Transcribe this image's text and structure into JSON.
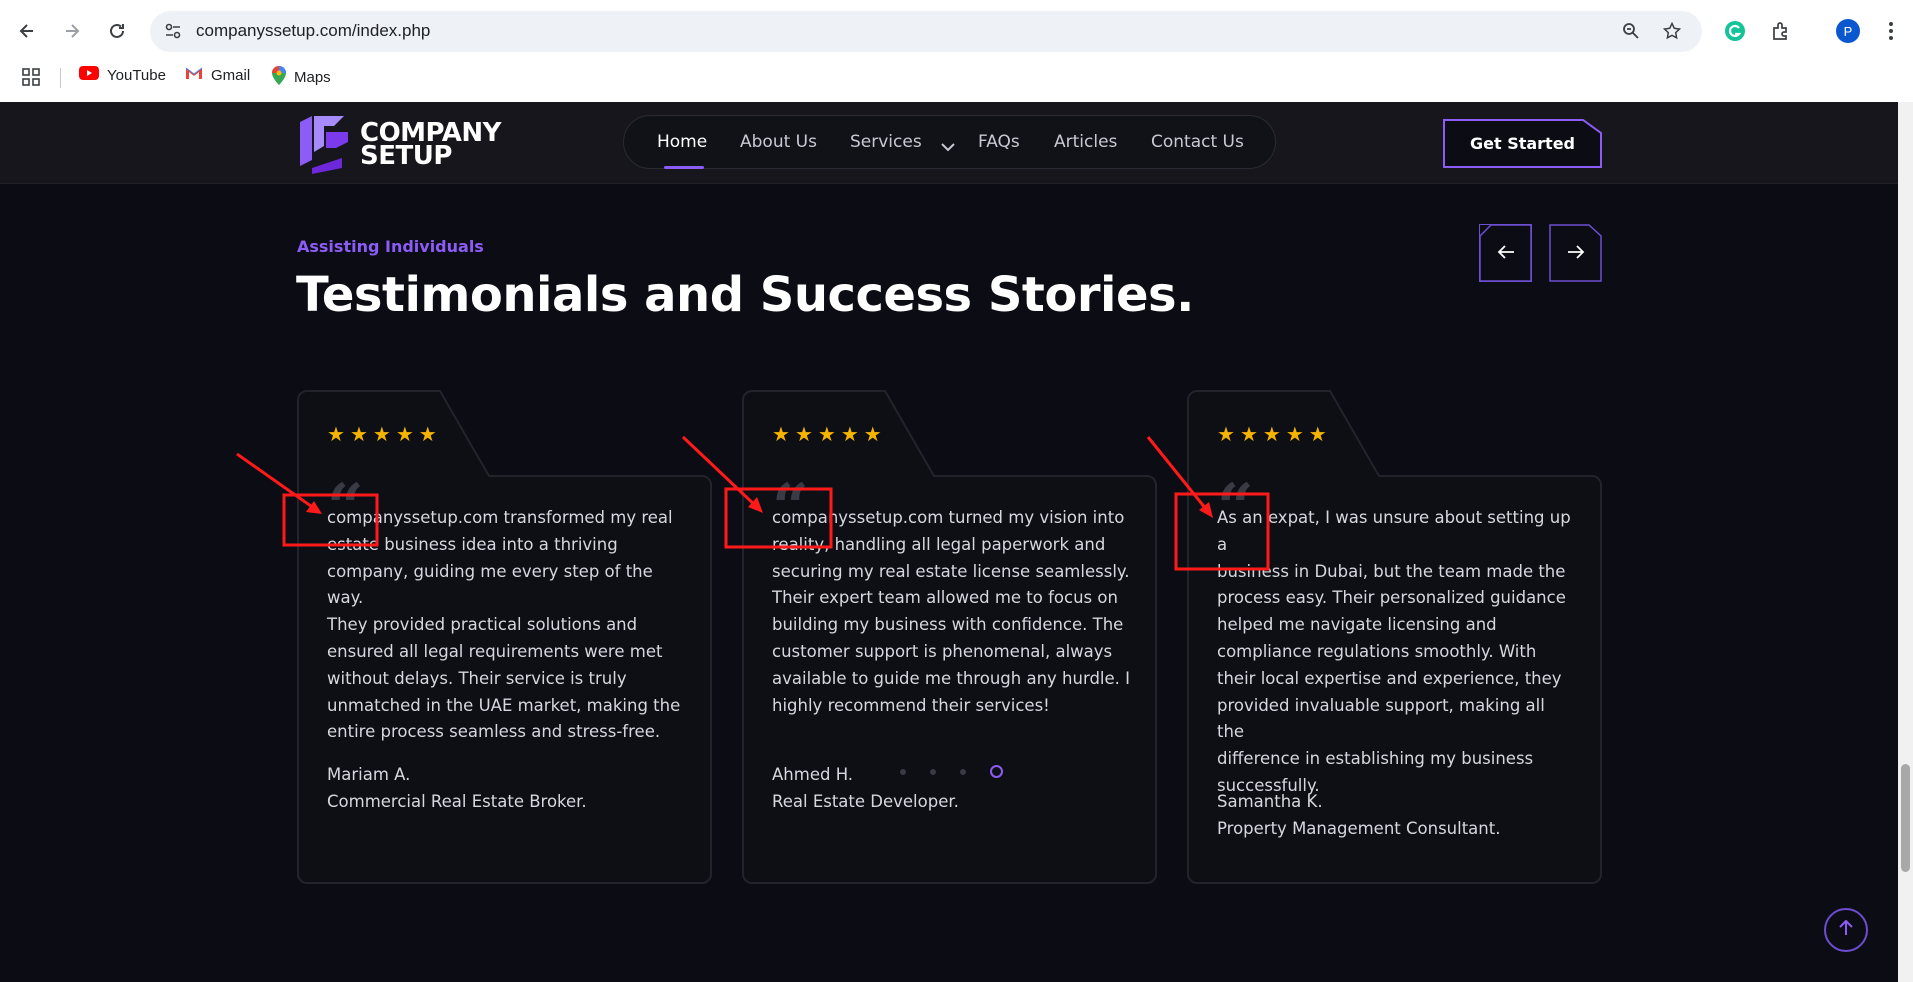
{
  "browser": {
    "url": "companyssetup.com/index.php",
    "bookmarks": [
      {
        "label": "YouTube",
        "icon": "youtube-icon"
      },
      {
        "label": "Gmail",
        "icon": "gmail-icon"
      },
      {
        "label": "Maps",
        "icon": "maps-icon"
      }
    ],
    "profile_initial": "P"
  },
  "header": {
    "logo_line1": "COMPANY",
    "logo_line2": "SETUP",
    "nav": [
      "Home",
      "About Us",
      "Services",
      "FAQs",
      "Articles",
      "Contact Us"
    ],
    "active_nav": "Home",
    "cta": "Get Started"
  },
  "section": {
    "eyebrow": "Assisting Individuals",
    "title": "Testimonials and Success Stories."
  },
  "testimonials": [
    {
      "rating": 5,
      "lines": [
        "companyssetup.com transformed my real",
        "estate business idea into a thriving",
        "company, guiding me every step of the way.",
        "They provided practical solutions and",
        "ensured all legal requirements were met",
        "without delays. Their service is truly",
        "unmatched in the UAE market, making the",
        "entire process seamless and stress-free."
      ],
      "name": "Mariam A.",
      "role": "Commercial Real Estate Broker."
    },
    {
      "rating": 5,
      "lines": [
        "companyssetup.com turned my vision into",
        "reality, handling all legal paperwork and",
        "securing my real estate license seamlessly.",
        "Their expert team allowed me to focus on",
        "building my business with confidence. The",
        "customer support is phenomenal, always",
        "available to guide me through any hurdle. I",
        "highly recommend their services!"
      ],
      "name": "Ahmed H.",
      "role": "Real Estate Developer."
    },
    {
      "rating": 5,
      "lines": [
        "As an expat, I was unsure about setting up a",
        "business in Dubai, but the team made the",
        "process easy. Their personalized guidance",
        "helped me navigate licensing and",
        "compliance regulations smoothly. With",
        "their local expertise and experience, they",
        "provided invaluable support, making all the",
        "difference in establishing my business",
        "successfully."
      ],
      "name": "Samantha K.",
      "role": "Property Management Consultant."
    }
  ],
  "carousel": {
    "page_count": 4,
    "active_page": 4
  },
  "colors": {
    "accent": "#8b5cf6",
    "star": "#f5b400",
    "annotation": "#ff1a1a",
    "background": "#0c0c14"
  }
}
